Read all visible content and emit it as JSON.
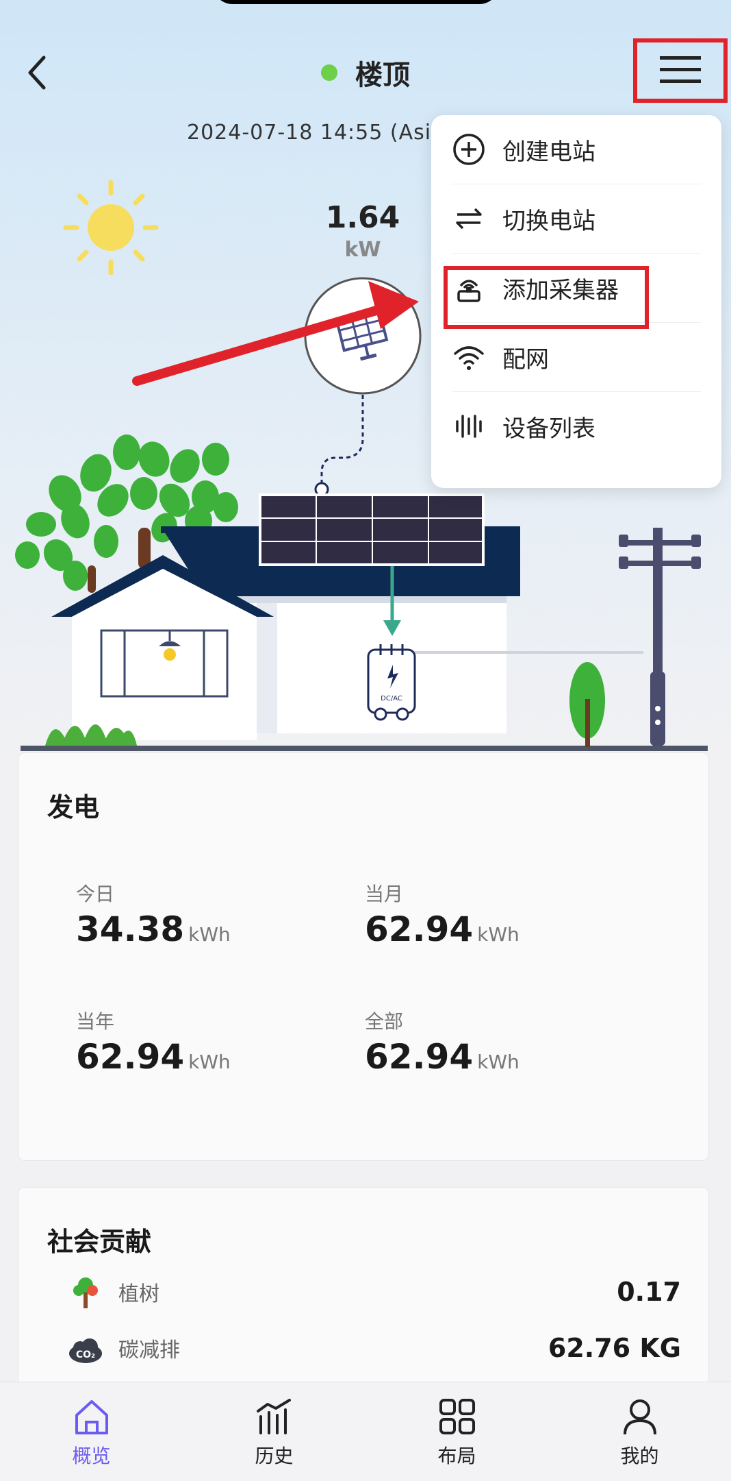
{
  "header": {
    "title": "楼顶",
    "status_color": "#6cd04a",
    "datetime": "2024-07-18 14:55 (Asia"
  },
  "pv": {
    "power_value": "1.64",
    "power_unit": "kW"
  },
  "menu": {
    "items": [
      {
        "label": "创建电站",
        "icon": "plus-circle-icon"
      },
      {
        "label": "切换电站",
        "icon": "swap-arrows-icon"
      },
      {
        "label": "添加采集器",
        "icon": "collector-icon"
      },
      {
        "label": "配网",
        "icon": "wifi-icon"
      },
      {
        "label": "设备列表",
        "icon": "device-list-icon"
      }
    ]
  },
  "inverter_label": "DC/AC",
  "generation": {
    "title": "发电",
    "stats": [
      {
        "label": "今日",
        "value": "34.38",
        "unit": "kWh"
      },
      {
        "label": "当月",
        "value": "62.94",
        "unit": "kWh"
      },
      {
        "label": "当年",
        "value": "62.94",
        "unit": "kWh"
      },
      {
        "label": "全部",
        "value": "62.94",
        "unit": "kWh"
      }
    ]
  },
  "social": {
    "title": "社会贡献",
    "rows": [
      {
        "label": "植树",
        "value": "0.17",
        "icon": "tree-icon"
      },
      {
        "label": "碳减排",
        "value": "62.76 KG",
        "icon": "co2-cloud-icon",
        "icon_text": "CO₂"
      }
    ]
  },
  "tabbar": {
    "tabs": [
      {
        "label": "概览",
        "icon": "home-icon",
        "active": true
      },
      {
        "label": "历史",
        "icon": "chart-icon",
        "active": false
      },
      {
        "label": "布局",
        "icon": "grid-icon",
        "active": false
      },
      {
        "label": "我的",
        "icon": "user-icon",
        "active": false
      }
    ]
  },
  "colors": {
    "accent": "#6a5cf0",
    "highlight": "#e0232a",
    "roof": "#0d2a52"
  }
}
